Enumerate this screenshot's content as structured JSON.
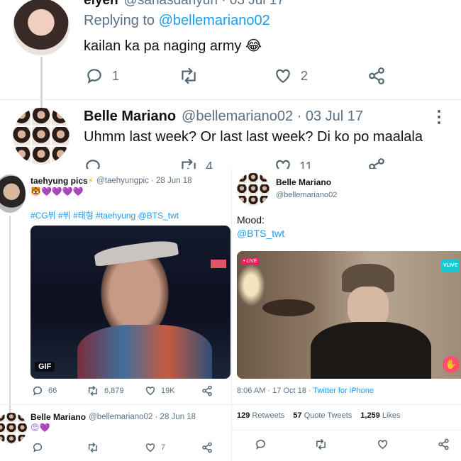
{
  "top": {
    "reply_tweet": {
      "name_partial": "elyen",
      "handle_partial": "@sanasdahyun · 03 Jul 17",
      "replying_prefix": "Replying to",
      "replying_handle": "@bellemariano02",
      "text": "kailan ka pa naging army",
      "emoji": "😂",
      "reply_count": "1",
      "like_count": "2"
    },
    "main_tweet": {
      "name": "Belle Mariano",
      "handle_date": "@bellemariano02 · 03 Jul 17",
      "text": "Uhmm last week? Or last last week? Di ko po maalala",
      "retweet_partial": "4",
      "like_partial": "11"
    }
  },
  "left": {
    "tweet1": {
      "name": "taehyung pics",
      "name_emoji": "⚡",
      "handle_date": "@taehyungpic · 28 Jun 18",
      "emoji_line": "🐯💜💜💜💜",
      "hashtags": "#CG뷔 #뷔 #태형 #taehyung @BTS_twt",
      "gif_label": "GIF",
      "replies": "66",
      "retweets": "6,879",
      "likes": "19K"
    },
    "tweet2": {
      "name": "Belle Mariano",
      "handle_date": "@bellemariano02 · 28 Jun 18",
      "emoji_line": "😍💜",
      "likes": "7"
    }
  },
  "right": {
    "name": "Belle Mariano",
    "handle": "@bellemariano02",
    "text_line1": "Mood:",
    "text_mention": "@BTS_twt",
    "live_badge": "• LIVE",
    "vlive_badge": "VLIVE",
    "timestamp": "8:06 AM · 17 Oct 18 ·",
    "source": "Twitter for iPhone",
    "retweets_num": "129",
    "retweets_label": "Retweets",
    "quotes_num": "57",
    "quotes_label": "Quote Tweets",
    "likes_num": "1,259",
    "likes_label": "Likes"
  },
  "icons": [
    "reply-icon",
    "retweet-icon",
    "like-icon",
    "share-icon",
    "more-icon"
  ],
  "colors": {
    "link": "#1d9bf0",
    "muted": "#5b7083",
    "purple_heart": "#9b6fd6"
  }
}
